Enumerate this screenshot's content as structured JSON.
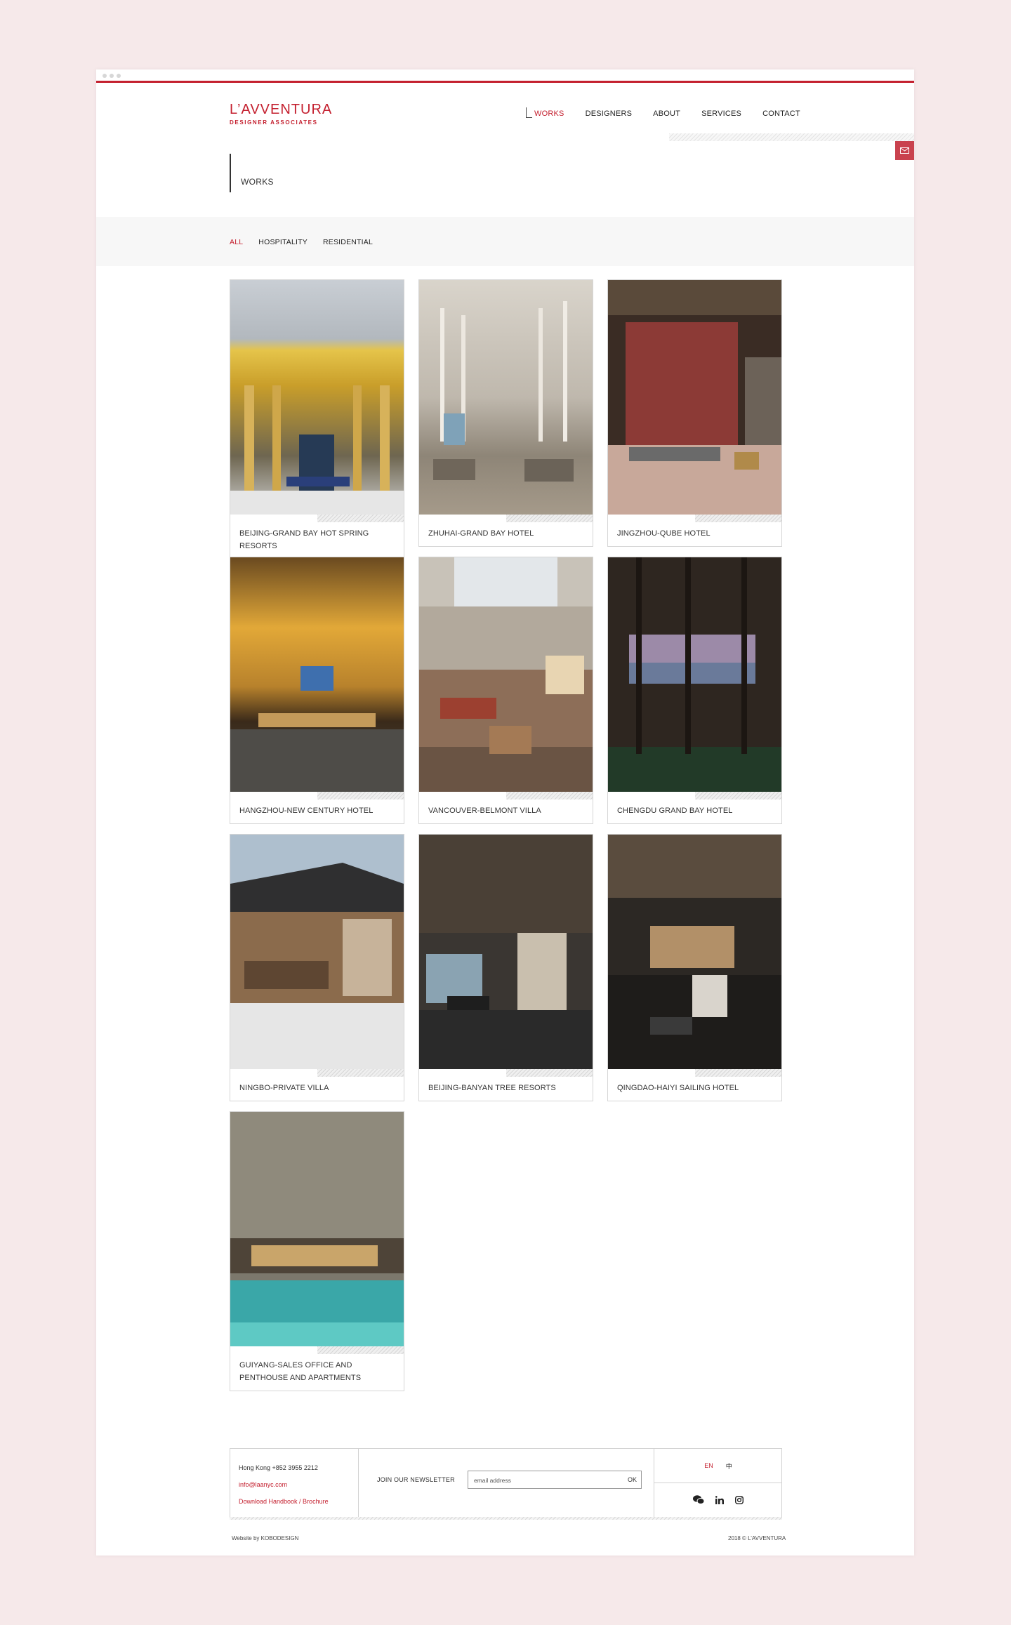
{
  "brand": {
    "name": "L’AVVENTURA",
    "tagline": "DESIGNER ASSOCIATES",
    "accent_color": "#c4202f"
  },
  "nav": {
    "items": [
      {
        "label": "WORKS",
        "active": true
      },
      {
        "label": "DESIGNERS",
        "active": false
      },
      {
        "label": "ABOUT",
        "active": false
      },
      {
        "label": "SERVICES",
        "active": false
      },
      {
        "label": "CONTACT",
        "active": false
      }
    ]
  },
  "mail_button": {
    "icon": "envelope-icon"
  },
  "page": {
    "title": "WORKS"
  },
  "filters": [
    {
      "label": "ALL",
      "active": true
    },
    {
      "label": "HOSPITALITY",
      "active": false
    },
    {
      "label": "RESIDENTIAL",
      "active": false
    }
  ],
  "projects": [
    {
      "title": "BEIJING-GRAND BAY HOT SPRING RESORTS"
    },
    {
      "title": "ZHUHAI-GRAND BAY HOTEL"
    },
    {
      "title": "JINGZHOU-QUBE HOTEL"
    },
    {
      "title": "HANGZHOU-NEW CENTURY HOTEL"
    },
    {
      "title": "VANCOUVER-BELMONT VILLA"
    },
    {
      "title": "CHENGDU GRAND BAY HOTEL"
    },
    {
      "title": "NINGBO-PRIVATE VILLA"
    },
    {
      "title": "BEIJING-BANYAN TREE RESORTS"
    },
    {
      "title": "QINGDAO-HAIYI SAILING HOTEL"
    },
    {
      "title": "GUIYANG-SALES OFFICE AND PENTHOUSE AND APARTMENTS"
    }
  ],
  "footer": {
    "phone": "Hong Kong +852 3955 2212",
    "email": "info@laanyc.com",
    "download": "Download Handbook / Brochure",
    "newsletter_label": "JOIN OUR NEWSLETTER",
    "newsletter_placeholder": "email address",
    "newsletter_submit": "OK",
    "languages": [
      {
        "label": "EN",
        "active": true
      },
      {
        "label": "中",
        "active": false
      }
    ],
    "social": [
      "wechat-icon",
      "linkedin-icon",
      "instagram-icon"
    ],
    "credit_left": "Website by KOBODESIGN",
    "credit_right": "2018 © L’AVVENTURA"
  }
}
